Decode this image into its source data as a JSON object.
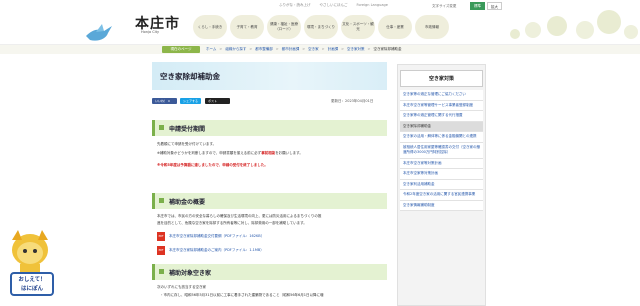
{
  "header": {
    "logo": "本庄市",
    "logo_sub": "Honjo City",
    "utility": [
      "ふりがな・読み上げ",
      "やさしいにほんご",
      "Foreign Language"
    ],
    "font_size_label": "文字サイズ変更",
    "font_std": "標準",
    "font_large": "拡大",
    "nav": [
      "くらし・手続き",
      "子育て・教育",
      "健康・福祉・医療（ロード）",
      "環境・まちづくり",
      "文化・スポーツ・観光",
      "仕事・産業",
      "市政情報"
    ]
  },
  "breadcrumb": {
    "tag": "現在のページ",
    "items": [
      "ホーム",
      "組織から探す",
      "都市整備部",
      "都市計画課",
      "空き家",
      "計画課",
      "空き家対策",
      "空き家除却補助金"
    ]
  },
  "main": {
    "title": "空き家除却補助金",
    "share_fb": "いいね！ 0",
    "share_line": "シェアする",
    "share_x": "ポスト",
    "updated": "更新日：2023年04月01日",
    "sections": {
      "s1": {
        "heading": "申請受付期間",
        "line1": "先着順にて申請を受け付けています。",
        "line2": "※補助対象かどうかを判断しますので、申請書類を揃える前に必ず",
        "line2_red": "事前相談",
        "line2_tail": "をお願いします。",
        "notice": "※令和5年度は予算額に達しましたので、申請の受付を終了しました。"
      },
      "s2": {
        "heading": "補助金の概要",
        "desc1": "本庄市では、市民の方の安全な暮らしの確保及び生活環境の向上、更には防災活用によるまちづくりの推",
        "desc2": "進を目的として、危険な空き家を除却する所有者等に対し、除却費用の一部を補助しています。",
        "pdf1": "本庄市空き家除却補助金交付要綱（PDFファイル：162KB）",
        "pdf2": "本庄市空き家除却補助金のご案内（PDFファイル：1.1MB）",
        "pdf_icon": "PDF"
      },
      "s3": {
        "heading": "補助対象空き家",
        "lead": "次のいずれにも該当する空き家",
        "bullet": "・市内に存し、昭和56年5月31日以前に工事に着手された建築物であること（昭和56年6月1日以降に増"
      }
    }
  },
  "sidebar": {
    "heading": "空き家対策",
    "items": [
      {
        "label": "空き家等の適正な管理にご協力ください",
        "active": false
      },
      {
        "label": "本庄市空き家等管理サービス事業者登録制度",
        "active": false
      },
      {
        "label": "空き家等の適正管理に関する代行措置",
        "active": false
      },
      {
        "label": "空き家除却補助金",
        "active": true
      },
      {
        "label": "空き家の活用・解体等に係る金融機関との連携",
        "active": false
      },
      {
        "label": "被相続人居住用家屋等確認書の交付（空き家の譲渡所得の3000万円特別控除）",
        "active": false
      },
      {
        "label": "本庄市空き家等対策計画",
        "active": false
      },
      {
        "label": "本庄市空家等対策計画",
        "active": false
      },
      {
        "label": "空き家利活用補助金",
        "active": false
      },
      {
        "label": "令和2年度空き家の活用に関する官民連携事業",
        "active": false
      },
      {
        "label": "空き家情報補助制度",
        "active": false
      }
    ]
  },
  "mascot": {
    "label_line1": "おしえて！",
    "label_line2": "はにぽん"
  }
}
